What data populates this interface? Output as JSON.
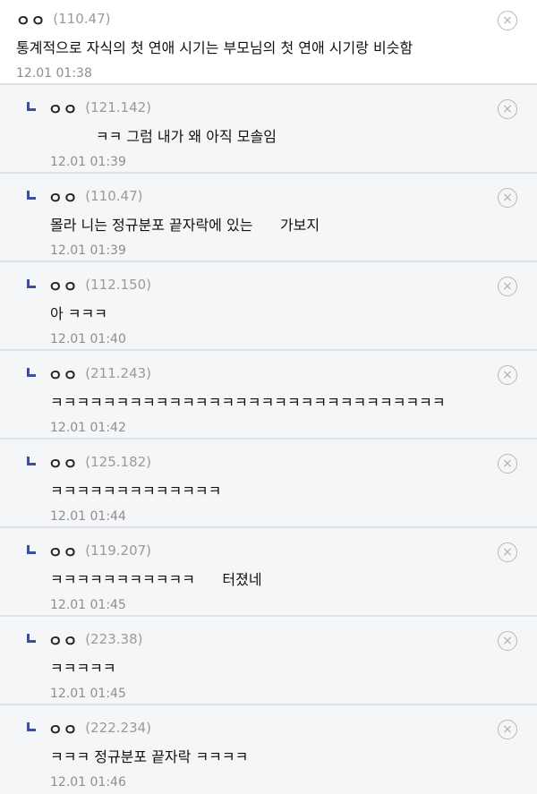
{
  "close_glyph": "×",
  "top_comment": {
    "nickname": "ㅇㅇ",
    "ip": "(110.47)",
    "text": "통계적으로 자식의 첫 연애 시기는 부모님의 첫 연애 시기랑 비슷함",
    "date": "12.01 01:38"
  },
  "replies": [
    {
      "nickname": "ㅇㅇ",
      "ip": "(121.142)",
      "text": "          ㅋㅋ 그럼 내가 왜 아직 모솔임",
      "date": "12.01 01:39"
    },
    {
      "nickname": "ㅇㅇ",
      "ip": "(110.47)",
      "text": "몰라 니는 정규분포 끝자락에 있는      가보지",
      "date": "12.01 01:39"
    },
    {
      "nickname": "ㅇㅇ",
      "ip": "(112.150)",
      "text": "아 ㅋㅋㅋ",
      "date": "12.01 01:40"
    },
    {
      "nickname": "ㅇㅇ",
      "ip": "(211.243)",
      "text": "ㅋㅋㅋㅋㅋㅋㅋㅋㅋㅋㅋㅋㅋㅋㅋㅋㅋㅋㅋㅋㅋㅋㅋㅋㅋㅋㅋㅋㅋㅋ",
      "date": "12.01 01:42"
    },
    {
      "nickname": "ㅇㅇ",
      "ip": "(125.182)",
      "text": "ㅋㅋㅋㅋㅋㅋㅋㅋㅋㅋㅋㅋㅋ",
      "date": "12.01 01:44"
    },
    {
      "nickname": "ㅇㅇ",
      "ip": "(119.207)",
      "text": "ㅋㅋㅋㅋㅋㅋㅋㅋㅋㅋㅋ      터졌네",
      "date": "12.01 01:45"
    },
    {
      "nickname": "ㅇㅇ",
      "ip": "(223.38)",
      "text": "ㅋㅋㅋㅋㅋ",
      "date": "12.01 01:45"
    },
    {
      "nickname": "ㅇㅇ",
      "ip": "(222.234)",
      "text": "ㅋㅋㅋ 정규분포 끝자락 ㅋㅋㅋㅋ",
      "date": "12.01 01:46"
    }
  ]
}
